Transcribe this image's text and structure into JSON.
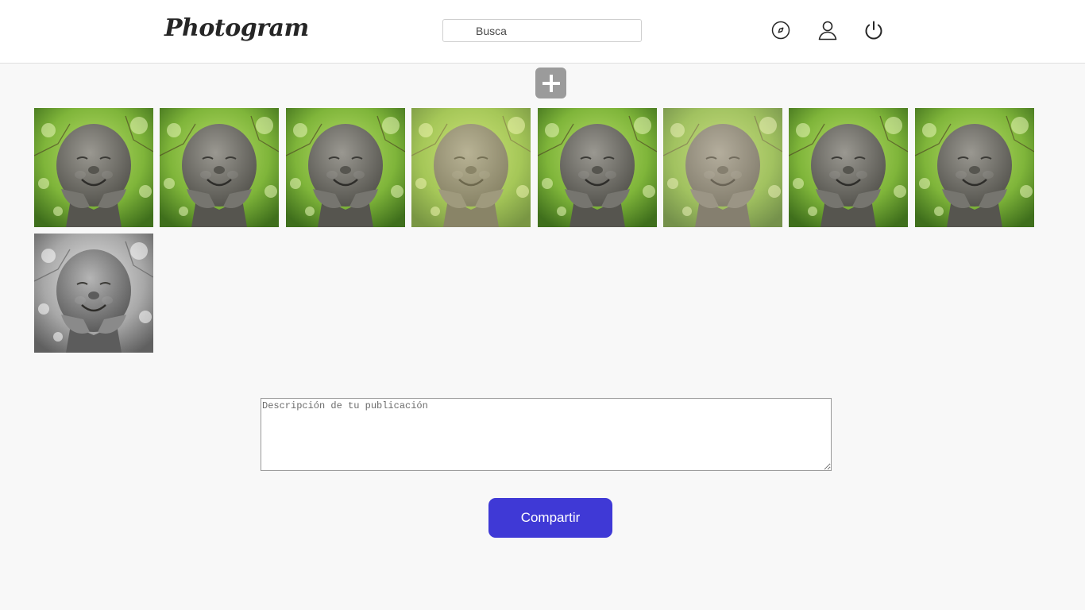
{
  "header": {
    "logo": "Photogram",
    "search_placeholder": "Busca",
    "icons": [
      "compass-icon",
      "user-icon",
      "power-icon"
    ]
  },
  "gallery": {
    "add_icon": "plus-icon",
    "thumbnails": [
      {
        "tint": "#ffffff",
        "gray": 0
      },
      {
        "tint": "#ffffff",
        "gray": 0
      },
      {
        "tint": "#ffffff",
        "gray": 0
      },
      {
        "tint": "#fff1a0",
        "gray": 0
      },
      {
        "tint": "#ffffff",
        "gray": 0.2
      },
      {
        "tint": "#f1e2b8",
        "gray": 0
      },
      {
        "tint": "#ffffff",
        "gray": 0
      },
      {
        "tint": "#ffffff",
        "gray": 0
      },
      {
        "tint": "#ffffff",
        "gray": 1
      }
    ]
  },
  "form": {
    "description_placeholder": "Descripción de tu publicación",
    "share_label": "Compartir"
  },
  "colors": {
    "accent": "#3f39d6",
    "header_bg": "#ffffff",
    "page_bg": "#f8f8f8",
    "add_button": "#9b9b9b"
  }
}
